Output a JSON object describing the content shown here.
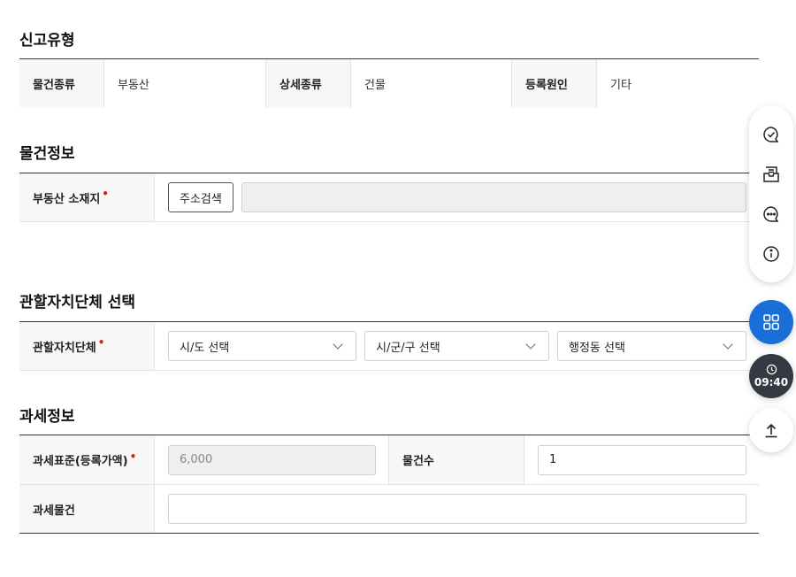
{
  "report_type": {
    "title": "신고유형",
    "cols": [
      {
        "label": "물건종류",
        "value": "부동산"
      },
      {
        "label": "상세종류",
        "value": "건물"
      },
      {
        "label": "등록원인",
        "value": "기타"
      }
    ]
  },
  "property_info": {
    "title": "물건정보",
    "location_label": "부동산 소재지",
    "required_mark": "•",
    "address_search_button": "주소검색",
    "address_value": ""
  },
  "jurisdiction": {
    "title": "관할자치단체 선택",
    "label": "관할자치단체",
    "required_mark": "•",
    "select_sido": "시/도 선택",
    "select_sigungu": "시/군/구 선택",
    "select_dong": "행정동 선택"
  },
  "tax_info": {
    "title": "과세정보",
    "tax_base_label": "과세표준(등록가액)",
    "required_mark": "•",
    "tax_base_value": "6,000",
    "item_count_label": "물건수",
    "item_count_value": "1",
    "taxable_item_label": "과세물건",
    "taxable_item_value": ""
  },
  "quick_menu": {
    "icons": [
      "chat-check-icon",
      "inbox-icon",
      "chat-dots-icon",
      "info-icon"
    ],
    "menu_icon": "grid-icon",
    "timer": "09:40",
    "timer_icon": "clock-icon",
    "top_icon": "arrow-up-icon"
  },
  "colors": {
    "accent": "#1a6ed8",
    "timer_bg": "#353941",
    "required": "#d9230f"
  }
}
